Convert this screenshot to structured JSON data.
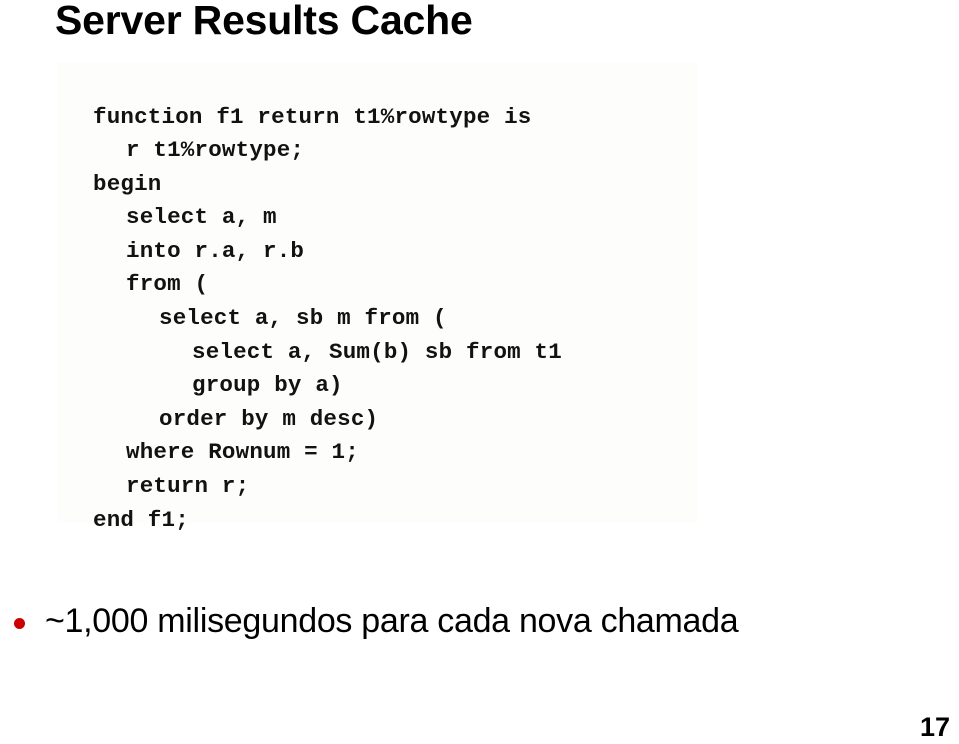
{
  "slide": {
    "title": "Server Results Cache",
    "page_number": "17"
  },
  "code_figure": {
    "language": "plsql",
    "background_color": "#fdfdfc",
    "text_color": "#121212",
    "lines": [
      {
        "indent": 0,
        "text": "function f1 return t1%rowtype is"
      },
      {
        "indent": 1,
        "text": "r t1%rowtype;"
      },
      {
        "indent": 0,
        "text": "begin"
      },
      {
        "indent": 1,
        "text": "select a, m"
      },
      {
        "indent": 1,
        "text": "into r.a, r.b"
      },
      {
        "indent": 1,
        "text": "from ("
      },
      {
        "indent": 2,
        "text": "select a, sb m from ("
      },
      {
        "indent": 3,
        "text": "select a, Sum(b) sb from t1"
      },
      {
        "indent": 3,
        "text": "group by a)"
      },
      {
        "indent": 2,
        "text": "order by m desc)"
      },
      {
        "indent": 1,
        "text": "where Rownum = 1;"
      },
      {
        "indent": 1,
        "text": "return r;"
      },
      {
        "indent": 0,
        "text": "end f1;"
      }
    ]
  },
  "bullets": [
    {
      "marker": "bullet-dot",
      "marker_color": "#cc0000",
      "text": "~1,000 milisegundos para cada nova chamada"
    }
  ]
}
